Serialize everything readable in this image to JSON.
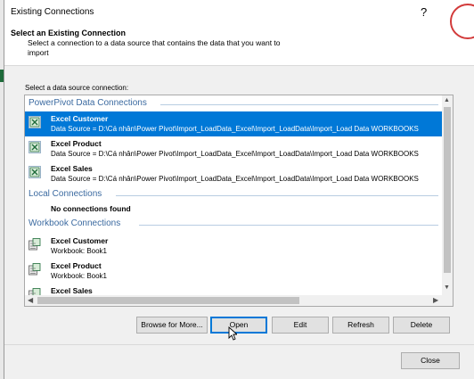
{
  "window": {
    "title": "Existing Connections",
    "help_glyph": "?"
  },
  "header": {
    "heading": "Select an Existing Connection",
    "description": "Select a connection to a data source that contains the data that you want to import"
  },
  "list": {
    "label": "Select a data source connection:",
    "groups": [
      {
        "title": "PowerPivot Data Connections",
        "items": [
          {
            "name": "Excel Customer",
            "detail": "Data Source = D:\\Cá nhân\\Power Pivot\\Import_LoadData_Excel\\Import_LoadData\\Import_Load Data WORKBOOKS",
            "selected": true
          },
          {
            "name": "Excel Product",
            "detail": "Data Source = D:\\Cá nhân\\Power Pivot\\Import_LoadData_Excel\\Import_LoadData\\Import_Load Data WORKBOOKS",
            "selected": false
          },
          {
            "name": "Excel Sales",
            "detail": "Data Source = D:\\Cá nhân\\Power Pivot\\Import_LoadData_Excel\\Import_LoadData\\Import_Load Data WORKBOOKS",
            "selected": false
          }
        ]
      },
      {
        "title": "Local Connections",
        "empty_text": "No connections found"
      },
      {
        "title": "Workbook Connections",
        "items": [
          {
            "name": "Excel Customer",
            "detail": "Workbook: Book1"
          },
          {
            "name": "Excel Product",
            "detail": "Workbook: Book1"
          },
          {
            "name": "Excel Sales",
            "detail": ""
          }
        ]
      }
    ]
  },
  "buttons": {
    "browse": "Browse for More...",
    "open": "Open",
    "edit": "Edit",
    "refresh": "Refresh",
    "delete": "Delete",
    "close": "Close"
  },
  "colors": {
    "selection": "#0078d7",
    "group_title": "#3b6aa0",
    "excel_green": "#1e6b3a"
  }
}
